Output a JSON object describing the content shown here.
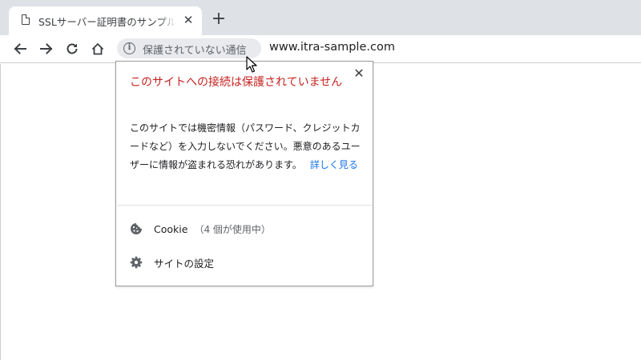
{
  "tab": {
    "title": "SSLサーバー証明書のサンプル",
    "close_label": "✕"
  },
  "newtab_label": "+",
  "omnibox": {
    "security_chip_text": "保護されていない通信",
    "url": "www.itra-sample.com"
  },
  "popup": {
    "close_label": "✕",
    "title": "このサイトへの接続は保護されていません",
    "body": "このサイトでは機密情報（パスワード、クレジットカードなど）を入力しないでください。悪意のあるユーザーに情報が盗まれる恐れがあります。",
    "link": "詳しく見る",
    "cookie_label": "Cookie",
    "cookie_count": "（4 個が使用中）",
    "site_settings_label": "サイトの設定"
  },
  "colors": {
    "warning_title": "#c5221f",
    "link": "#1a73e8",
    "tabstrip": "#dee1e6"
  },
  "icons": {
    "tab": "document-icon",
    "back": "arrow-left-icon",
    "forward": "arrow-right-icon",
    "reload": "reload-icon",
    "home": "home-icon",
    "info": "info-icon",
    "cookie": "cookie-icon",
    "settings": "gear-icon"
  }
}
